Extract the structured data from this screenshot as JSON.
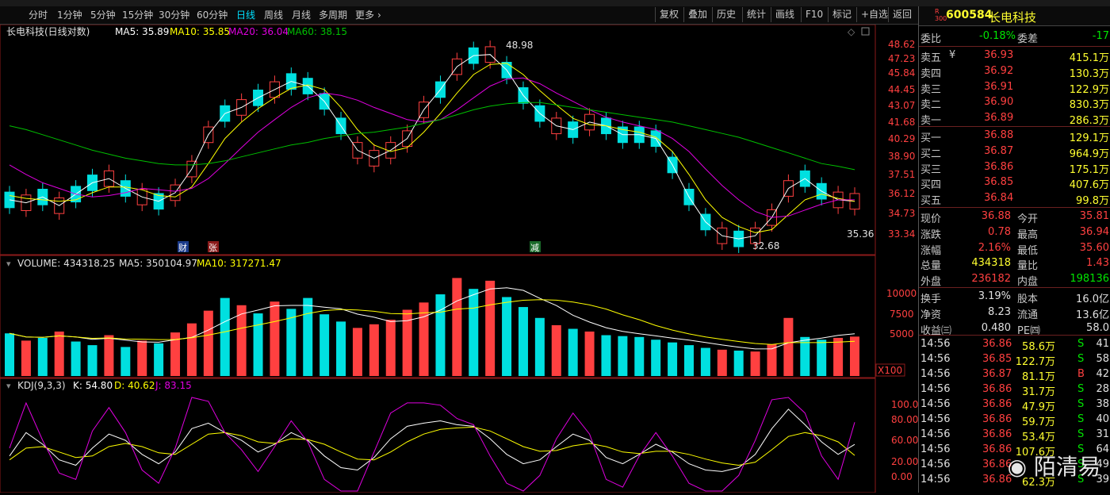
{
  "toolbar": {
    "periods": [
      "分时",
      "1分钟",
      "5分钟",
      "15分钟",
      "30分钟",
      "60分钟",
      "日线",
      "周线",
      "月线",
      "多周期",
      "更多"
    ],
    "buttons": [
      "复权",
      "叠加",
      "历史",
      "统计",
      "画线",
      "F10",
      "标记",
      "+自选",
      "返回"
    ]
  },
  "main": {
    "title": "长电科技(日线对数)",
    "ma5": "MA5: 35.89",
    "ma10": "MA10: 35.85",
    "ma20": "MA20: 36.04",
    "ma60": "MA60: 38.15",
    "yticks": [
      "48.62",
      "47.23",
      "45.84",
      "44.45",
      "43.07",
      "41.68",
      "40.29",
      "38.90",
      "37.51",
      "36.12",
      "34.73",
      "33.34"
    ],
    "high_label": "48.98",
    "low_label": "32.68",
    "last_label": "35.36",
    "markers": [
      "财",
      "张",
      "减"
    ]
  },
  "volume": {
    "title": "VOLUME: 434318.25",
    "ma5": "MA5: 350104.97",
    "ma10": "MA10: 317271.47",
    "yticks": [
      "10000",
      "7500",
      "5000"
    ],
    "unit": "X100"
  },
  "kdj": {
    "title": "KDJ(9,3,3)",
    "k": "K: 54.80",
    "d": "D: 40.62",
    "j": "J: 83.15",
    "yticks": [
      "100.00",
      "80.00",
      "60.00",
      "20.00",
      "0.00"
    ]
  },
  "quote": {
    "code": "600584",
    "name": "长电科技",
    "badge_top": "R",
    "badge_bottom": "300",
    "wb_label": "委比",
    "wb": "-0.18%",
    "wc_label": "委差",
    "wc": "-17",
    "asks": [
      {
        "label": "卖五",
        "mark": "¥",
        "price": "36.93",
        "vol": "415.1万"
      },
      {
        "label": "卖四",
        "mark": "",
        "price": "36.92",
        "vol": "130.3万"
      },
      {
        "label": "卖三",
        "mark": "",
        "price": "36.91",
        "vol": "122.9万"
      },
      {
        "label": "卖二",
        "mark": "",
        "price": "36.90",
        "vol": "830.3万"
      },
      {
        "label": "卖一",
        "mark": "",
        "price": "36.89",
        "vol": "286.3万"
      }
    ],
    "bids": [
      {
        "label": "买一",
        "price": "36.88",
        "vol": "129.1万"
      },
      {
        "label": "买二",
        "price": "36.87",
        "vol": "964.9万"
      },
      {
        "label": "买三",
        "price": "36.86",
        "vol": "175.1万"
      },
      {
        "label": "买四",
        "price": "36.85",
        "vol": "407.6万"
      },
      {
        "label": "买五",
        "price": "36.84",
        "vol": "99.8万"
      }
    ],
    "stats": [
      {
        "l1": "现价",
        "v1": "36.88",
        "c1": "up",
        "l2": "今开",
        "v2": "35.81",
        "c2": "up"
      },
      {
        "l1": "涨跌",
        "v1": "0.78",
        "c1": "up",
        "l2": "最高",
        "v2": "36.94",
        "c2": "up"
      },
      {
        "l1": "涨幅",
        "v1": "2.16%",
        "c1": "up",
        "l2": "最低",
        "v2": "35.60",
        "c2": "up"
      },
      {
        "l1": "总量",
        "v1": "434318",
        "c1": "yel",
        "l2": "量比",
        "v2": "1.43",
        "c2": "up"
      },
      {
        "l1": "外盘",
        "v1": "236182",
        "c1": "up",
        "l2": "内盘",
        "v2": "198136",
        "c2": "grn"
      }
    ],
    "fund": [
      {
        "l1": "换手",
        "v1": "3.19%",
        "l2": "股本",
        "v2": "16.0亿"
      },
      {
        "l1": "净资",
        "v1": "8.23",
        "l2": "流通",
        "v2": "13.6亿"
      },
      {
        "l1": "收益㈢",
        "v1": "0.480",
        "l2": "PE㈣",
        "v2": "58.0"
      }
    ],
    "ticks": [
      {
        "t": "14:56",
        "p": "36.86",
        "v": "58.6万",
        "s": "S",
        "n": "41"
      },
      {
        "t": "14:56",
        "p": "36.85",
        "v": "122.7万",
        "s": "S",
        "n": "58"
      },
      {
        "t": "14:56",
        "p": "36.87",
        "v": "81.1万",
        "s": "B",
        "n": "42"
      },
      {
        "t": "14:56",
        "p": "36.86",
        "v": "31.7万",
        "s": "S",
        "n": "28"
      },
      {
        "t": "14:56",
        "p": "36.86",
        "v": "47.9万",
        "s": "S",
        "n": "38"
      },
      {
        "t": "14:56",
        "p": "36.86",
        "v": "59.7万",
        "s": "S",
        "n": "40"
      },
      {
        "t": "14:56",
        "p": "36.86",
        "v": "53.4万",
        "s": "S",
        "n": "31"
      },
      {
        "t": "14:56",
        "p": "36.86",
        "v": "107.6万",
        "s": "S",
        "n": "64"
      },
      {
        "t": "14:56",
        "p": "36.86",
        "v": "",
        "s": "S",
        "n": "49"
      },
      {
        "t": "14:56",
        "p": "36.86",
        "v": "62.3万",
        "s": "S",
        "n": "39"
      }
    ]
  },
  "watermark": "陌清易",
  "colors": {
    "up": "#ff4040",
    "down": "#00e0e0",
    "ma5": "#ffffff",
    "ma10": "#ffff00",
    "ma20": "#e000e0",
    "ma60": "#00c000",
    "accent": "#00e0ff"
  },
  "chart_data": [
    {
      "type": "line",
      "title": "长电科技(日线对数)",
      "ylim": [
        32.5,
        49.2
      ],
      "series": [
        {
          "name": "MA5",
          "values": [
            36.0,
            35.8,
            36.2,
            35.6,
            36.4,
            37.2,
            37.5,
            36.8,
            36.2,
            35.9,
            36.5,
            38.2,
            40.8,
            42.5,
            43.0,
            43.8,
            44.5,
            45.2,
            44.8,
            43.5,
            41.5,
            39.6,
            39.0,
            39.6,
            40.5,
            42.8,
            44.5,
            46.5,
            47.5,
            47.6,
            46.2,
            44.0,
            42.5,
            41.5,
            41.2,
            41.8,
            41.5,
            40.8,
            40.8,
            40.5,
            38.5,
            36.2,
            34.5,
            33.6,
            33.4,
            33.6,
            34.8,
            36.8,
            37.5,
            36.6,
            36.0,
            35.9
          ]
        },
        {
          "name": "MA10",
          "values": [
            36.3,
            36.1,
            36.0,
            35.9,
            36.0,
            36.5,
            36.9,
            36.9,
            36.7,
            36.3,
            36.2,
            36.9,
            38.6,
            40.5,
            41.8,
            42.9,
            43.8,
            44.6,
            44.9,
            44.5,
            43.0,
            41.2,
            40.0,
            39.5,
            39.8,
            41.0,
            42.5,
            44.2,
            45.8,
            46.7,
            46.8,
            45.8,
            44.4,
            43.2,
            42.1,
            41.6,
            41.5,
            41.2,
            41.0,
            40.6,
            39.5,
            37.8,
            36.0,
            34.8,
            34.2,
            33.8,
            34.0,
            35.0,
            36.0,
            36.4,
            36.1,
            35.9
          ]
        },
        {
          "name": "MA20",
          "values": [
            38.5,
            37.8,
            37.2,
            36.8,
            36.4,
            36.2,
            36.3,
            36.5,
            36.8,
            36.7,
            36.6,
            36.8,
            37.5,
            38.6,
            39.8,
            41.0,
            42.0,
            43.0,
            43.8,
            44.2,
            44.0,
            43.6,
            43.0,
            42.5,
            42.0,
            41.8,
            42.0,
            42.8,
            43.8,
            44.8,
            45.4,
            45.5,
            45.0,
            44.2,
            43.5,
            42.8,
            42.2,
            41.8,
            41.5,
            41.2,
            40.5,
            39.5,
            38.2,
            37.0,
            36.0,
            35.2,
            34.8,
            34.9,
            35.3,
            35.7,
            36.0,
            36.0
          ]
        },
        {
          "name": "MA60",
          "values": [
            41.5,
            41.2,
            40.8,
            40.4,
            40.0,
            39.6,
            39.3,
            39.0,
            38.8,
            38.6,
            38.5,
            38.5,
            38.6,
            38.8,
            39.1,
            39.4,
            39.7,
            40.0,
            40.2,
            40.5,
            40.7,
            40.9,
            41.0,
            41.2,
            41.4,
            41.7,
            42.0,
            42.4,
            42.8,
            43.1,
            43.3,
            43.4,
            43.4,
            43.2,
            43.0,
            42.8,
            42.6,
            42.4,
            42.2,
            42.0,
            41.8,
            41.5,
            41.2,
            40.9,
            40.6,
            40.2,
            39.8,
            39.4,
            39.0,
            38.6,
            38.4,
            38.15
          ]
        }
      ],
      "annotations": [
        "48.98",
        "32.68",
        "35.36"
      ]
    },
    {
      "type": "bar",
      "title": "VOLUME: 434318.25",
      "ylabel": "X100",
      "ylim": [
        0,
        12500
      ],
      "values": [
        4700,
        3900,
        4200,
        4900,
        3800,
        3400,
        4500,
        3200,
        3900,
        3600,
        4800,
        5800,
        7200,
        8600,
        7800,
        6900,
        8200,
        7400,
        8600,
        6800,
        6000,
        5300,
        5700,
        6200,
        7300,
        8100,
        9000,
        10800,
        9600,
        10500,
        8700,
        7600,
        6400,
        5600,
        5200,
        4900,
        4500,
        4400,
        4300,
        4000,
        3700,
        3400,
        3100,
        2900,
        2800,
        2700,
        3500,
        6400,
        4300,
        4000,
        4200,
        4343
      ],
      "up": [
        false,
        true,
        false,
        true,
        false,
        false,
        true,
        false,
        true,
        false,
        true,
        true,
        true,
        false,
        true,
        false,
        true,
        false,
        false,
        false,
        false,
        true,
        true,
        true,
        true,
        true,
        false,
        true,
        false,
        true,
        false,
        false,
        false,
        true,
        false,
        true,
        false,
        false,
        false,
        false,
        false,
        false,
        false,
        true,
        false,
        true,
        true,
        true,
        false,
        false,
        true,
        true
      ]
    },
    {
      "type": "line",
      "title": "KDJ(9,3,3)",
      "ylim": [
        -5,
        115
      ],
      "series": [
        {
          "name": "K",
          "values": [
            40,
            70,
            55,
            35,
            28,
            50,
            68,
            60,
            42,
            30,
            45,
            75,
            82,
            70,
            60,
            45,
            55,
            70,
            60,
            40,
            25,
            22,
            38,
            62,
            78,
            82,
            85,
            80,
            78,
            62,
            42,
            30,
            35,
            52,
            68,
            60,
            38,
            30,
            42,
            55,
            45,
            30,
            22,
            20,
            25,
            42,
            75,
            100,
            80,
            58,
            42,
            54.8
          ]
        },
        {
          "name": "D",
          "values": [
            35,
            50,
            52,
            45,
            38,
            40,
            52,
            56,
            52,
            44,
            42,
            55,
            68,
            70,
            66,
            58,
            56,
            62,
            61,
            55,
            45,
            36,
            35,
            45,
            58,
            68,
            74,
            76,
            77,
            72,
            62,
            52,
            46,
            47,
            53,
            56,
            52,
            45,
            43,
            46,
            46,
            42,
            36,
            31,
            28,
            32,
            48,
            65,
            70,
            66,
            58,
            40.62
          ]
        },
        {
          "name": "J",
          "values": [
            50,
            108,
            60,
            18,
            10,
            72,
            102,
            70,
            22,
            5,
            50,
            115,
            110,
            70,
            48,
            20,
            52,
            85,
            58,
            10,
            -5,
            -5,
            45,
            95,
            108,
            108,
            105,
            88,
            80,
            40,
            5,
            -5,
            15,
            62,
            95,
            68,
            10,
            0,
            40,
            70,
            40,
            5,
            -5,
            -5,
            15,
            60,
            112,
            115,
            95,
            40,
            10,
            83.15
          ]
        }
      ]
    }
  ]
}
